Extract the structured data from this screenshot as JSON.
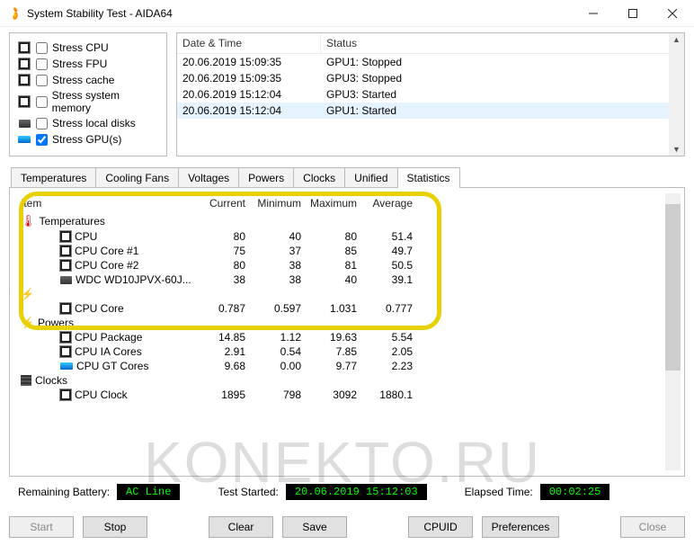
{
  "window": {
    "title": "System Stability Test - AIDA64",
    "min_label": "Minimize",
    "max_label": "Maximize",
    "close_label": "Close"
  },
  "stress": {
    "items": [
      {
        "label": "Stress CPU",
        "checked": false,
        "icon": "cpu"
      },
      {
        "label": "Stress FPU",
        "checked": false,
        "icon": "cpu"
      },
      {
        "label": "Stress cache",
        "checked": false,
        "icon": "cache"
      },
      {
        "label": "Stress system memory",
        "checked": false,
        "icon": "mem"
      },
      {
        "label": "Stress local disks",
        "checked": false,
        "icon": "disk"
      },
      {
        "label": "Stress GPU(s)",
        "checked": true,
        "icon": "gpu"
      }
    ]
  },
  "events": {
    "col1": "Date & Time",
    "col2": "Status",
    "rows": [
      {
        "dt": "20.06.2019 15:09:35",
        "st": "GPU1: Stopped",
        "sel": false
      },
      {
        "dt": "20.06.2019 15:09:35",
        "st": "GPU3: Stopped",
        "sel": false
      },
      {
        "dt": "20.06.2019 15:12:04",
        "st": "GPU3: Started",
        "sel": false
      },
      {
        "dt": "20.06.2019 15:12:04",
        "st": "GPU1: Started",
        "sel": true
      }
    ]
  },
  "tabs": [
    "Temperatures",
    "Cooling Fans",
    "Voltages",
    "Powers",
    "Clocks",
    "Unified",
    "Statistics"
  ],
  "active_tab": 6,
  "stats": {
    "headers": {
      "item": "Item",
      "cur": "Current",
      "min": "Minimum",
      "max": "Maximum",
      "avg": "Average"
    },
    "groups": [
      {
        "name": "Temperatures",
        "icon": "therm",
        "rows": [
          {
            "name": "CPU",
            "icon": "cpu",
            "cur": "80",
            "min": "40",
            "max": "80",
            "avg": "51.4"
          },
          {
            "name": "CPU Core #1",
            "icon": "cpu",
            "cur": "75",
            "min": "37",
            "max": "85",
            "avg": "49.7"
          },
          {
            "name": "CPU Core #2",
            "icon": "cpu",
            "cur": "80",
            "min": "38",
            "max": "81",
            "avg": "50.5"
          },
          {
            "name": "WDC WD10JPVX-60J...",
            "icon": "disk",
            "cur": "38",
            "min": "38",
            "max": "40",
            "avg": "39.1"
          }
        ]
      },
      {
        "name": "",
        "icon": "bolt",
        "rows": [
          {
            "name": "CPU Core",
            "icon": "cpu",
            "cur": "0.787",
            "min": "0.597",
            "max": "1.031",
            "avg": "0.777"
          }
        ]
      },
      {
        "name": "Powers",
        "icon": "bolt",
        "rows": [
          {
            "name": "CPU Package",
            "icon": "cpu",
            "cur": "14.85",
            "min": "1.12",
            "max": "19.63",
            "avg": "5.54"
          },
          {
            "name": "CPU IA Cores",
            "icon": "cpu",
            "cur": "2.91",
            "min": "0.54",
            "max": "7.85",
            "avg": "2.05"
          },
          {
            "name": "CPU GT Cores",
            "icon": "gpu",
            "cur": "9.68",
            "min": "0.00",
            "max": "9.77",
            "avg": "2.23"
          }
        ]
      },
      {
        "name": "Clocks",
        "icon": "clock",
        "rows": [
          {
            "name": "CPU Clock",
            "icon": "cpu",
            "cur": "1895",
            "min": "798",
            "max": "3092",
            "avg": "1880.1"
          }
        ]
      }
    ]
  },
  "status": {
    "battery_label": "Remaining Battery:",
    "battery_val": "AC Line",
    "started_label": "Test Started:",
    "started_val": "20.06.2019 15:12:03",
    "elapsed_label": "Elapsed Time:",
    "elapsed_val": "00:02:25"
  },
  "buttons": {
    "start": "Start",
    "stop": "Stop",
    "clear": "Clear",
    "save": "Save",
    "cpuid": "CPUID",
    "prefs": "Preferences",
    "close": "Close"
  },
  "watermark": "KONEKTO.RU"
}
